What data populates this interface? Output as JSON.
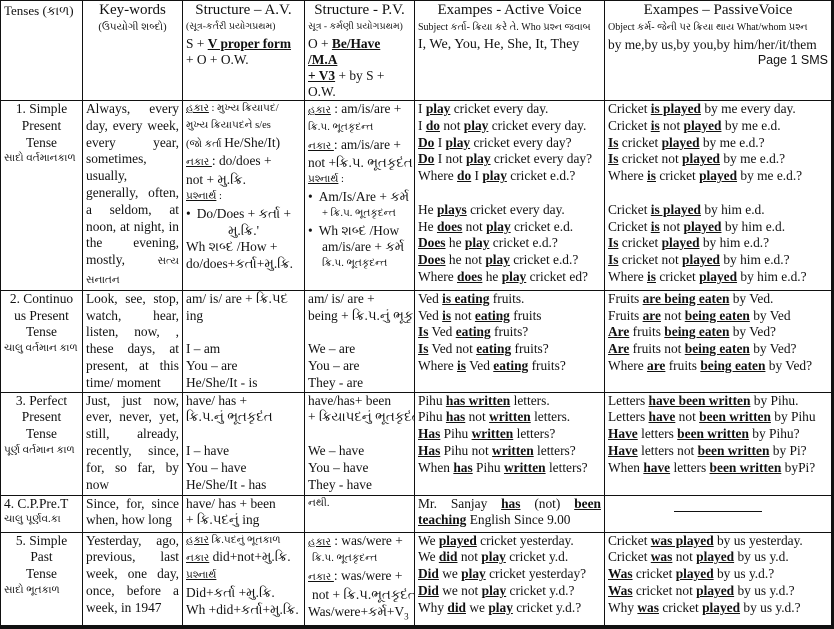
{
  "header": {
    "tenses": "Tenses (કાળ)",
    "keywords_title": "Key-words",
    "keywords_sub": "(ઉપયોગી શબ્દો)",
    "structure_av_title": "Structure – A.V.",
    "structure_av_sub": "(સૂત્ર-કર્તરી પ્રયોગપ્રથમ)",
    "structure_av_formula_s": "S + ",
    "structure_av_formula_v": "V proper form ",
    "structure_av_formula_end": "+ O + O.W.",
    "structure_pv_title": "Structure - P.V.",
    "structure_pv_sub": "સૂત્ર - કર્મણી પ્રયોગપ્રથમ)",
    "structure_pv_formula_o": "O + ",
    "structure_pv_formula_be": "Be/Have /M.A",
    "structure_pv_formula_v3": "+ V3",
    "structure_pv_formula_end": " + by S + O.W.",
    "active_title": "Exampes - Active Voice",
    "active_sub": "Subject કર્તા- ક્રિયા કરે તે. Who પ્રશ્ન જવાબ",
    "active_pronouns": "I,  We, You, He, She, It, They",
    "passive_title": "Exampes – PassiveVoice",
    "passive_sub": "Object કર્મ- જેની પર ક્રિયા થાય What/whom  પ્રશ્ન",
    "passive_pronouns": "by me,by us,by you,by him/her/it/them",
    "page_label": "Page 1 SMS"
  },
  "rows": [
    {
      "tense": [
        "1. Simple",
        "Present",
        "Tense"
      ],
      "tense_gu": "સાદો વર્તમાનકાળ",
      "keywords": "Always, every day, every week, every year, sometimes, usually, generally, often, a seldom, at noon, at night, in the evening, mostly,",
      "keywords_gu": "સત્ય સનાતન",
      "structure_av": {
        "l1_label": "હકાર",
        "l1": " : મુખ્ય ક્રિયાપદ/",
        "l2": "મુખ્ય ક્રિયાપદને s/es",
        "l3_gu": "(જો કર્તા ",
        "l3": "He/She/It)",
        "l4_label": "નકાર ",
        "l4": ": do/does +",
        "l5": "not + મુ.ક્રિ.",
        "l6_label": "પ્રશ્નાર્થ",
        "l6": " :",
        "l7": "Do/Does + કર્તા +",
        "l8": "મુ.ક્રિ.'",
        "l9": "Wh શબ્દ /How +",
        "l10": "do/does+કર્તા+મુ.ક્રિ."
      },
      "structure_pv": {
        "l1_label": "હકાર",
        "l1": " : am/is/are +",
        "l2": "ક્રિ.પ. ભૂતકૃદન્ત",
        "l3_label": "નકાર ",
        "l3": ": am/is/are +",
        "l4": "not +ક્રિ.પ. ભૂતકૃદંત",
        "l5_label": "પ્રશ્નાર્થ",
        "l5": " :",
        "l6": "Am/Is/Are + કર્મ",
        "l7": "+ ક્રિ.પ. ભૂતકૃદન્ત",
        "l8": "Wh શબ્દ /How",
        "l9": "am/is/are + કર્મ",
        "l10": "ક્રિ.પ. ભૂતકૃદન્ત"
      },
      "active": [
        [
          "I ",
          "play",
          " cricket every day."
        ],
        [
          "I ",
          "do",
          " not ",
          "play",
          " cricket every day."
        ],
        [
          "Do",
          " I ",
          "play",
          " cricket every day?"
        ],
        [
          "Do",
          " I not ",
          "play",
          " cricket every day?"
        ],
        [
          "Where ",
          "do",
          " I ",
          "play",
          " cricket e.d.?"
        ],
        [
          "He ",
          "plays",
          " cricket every day."
        ],
        [
          "He ",
          "does",
          " not ",
          "play",
          " cricket e.d."
        ],
        [
          "Does",
          " he ",
          "play",
          " cricket e.d.?"
        ],
        [
          "Does",
          " he not  ",
          "play",
          " cricket e.d.?"
        ],
        [
          "Where ",
          "does",
          " he ",
          "play",
          " cricket ed?"
        ]
      ],
      "passive": [
        [
          "Cricket ",
          "is played",
          " by me every day."
        ],
        [
          "Cricket ",
          "is",
          " not ",
          "played",
          " by me e.d."
        ],
        [
          "Is",
          " cricket ",
          "played",
          " by me e.d.?"
        ],
        [
          "Is",
          " cricket not ",
          "played",
          " by me e.d.?"
        ],
        [
          "Where ",
          "is",
          " cricket ",
          "played",
          " by me e.d.?"
        ],
        [
          "Cricket ",
          "is played",
          " by him e.d."
        ],
        [
          "Cricket ",
          "is",
          " not ",
          "played",
          " by him e.d."
        ],
        [
          "Is",
          " cricket ",
          "played",
          " by him e.d.?"
        ],
        [
          "Is",
          " cricket not  ",
          "played",
          " by him e.d.?"
        ],
        [
          "Where ",
          "is",
          " cricket ",
          "played",
          " by him e.d.?"
        ]
      ]
    },
    {
      "tense": [
        "2. Continuo",
        "us Present",
        "Tense"
      ],
      "tense_gu": "ચાલુ વર્તમાન કાળ",
      "keywords": "Look, see, stop, watch, hear, listen, now, , these days, at present, at this time/ moment",
      "structure_av": [
        "am/ is/ are + ક્રિ.પદ",
        "ing",
        "",
        "I – am",
        "You – are",
        "He/She/It - is"
      ],
      "structure_pv": [
        "am/ is/ are +",
        "being + ક્રિ.પ.નું ભૂકૃ",
        "",
        "We – are",
        "You – are",
        "They - are"
      ],
      "active": [
        [
          "Ved ",
          "is eating",
          " fruits."
        ],
        [
          "Ved ",
          "is",
          " not ",
          "eating",
          " fruits"
        ],
        [
          "Is",
          " Ved ",
          "eating",
          " fruits?"
        ],
        [
          "Is",
          " Ved not ",
          "eating",
          " fruits?"
        ],
        [
          "Where ",
          "is",
          " Ved ",
          "eating",
          " fruits?"
        ]
      ],
      "passive": [
        [
          "Fruits ",
          "are being eaten",
          " by Ved."
        ],
        [
          "Fruits ",
          "are",
          " not ",
          "being eaten",
          " by  Ved"
        ],
        [
          "Are",
          " fruits ",
          "being eaten",
          " by Ved?"
        ],
        [
          "Are",
          " fruits not ",
          "being eaten",
          " by Ved?"
        ],
        [
          "Where ",
          "are",
          "  fruits ",
          "being eaten",
          " by Ved?"
        ]
      ]
    },
    {
      "tense": [
        "3. Perfect",
        "Present",
        "Tense"
      ],
      "tense_gu": "પૂર્ણ વર્તમાન કાળ",
      "keywords": "Just, just now, ever, never, yet, still, already, recently, since, for, so far, by now",
      "structure_av": [
        "have/ has +",
        "ક્રિ.પ.નું ભૂતકૃદંત",
        "",
        "I – have",
        "You – have",
        "He/She/It - has"
      ],
      "structure_pv": [
        "have/has+ been",
        "+ ક્રિયાપદનું ભૂતકૃદંત",
        "",
        "We – have",
        "You – have",
        "They -  have"
      ],
      "active": [
        [
          "Pihu ",
          "has written",
          " letters."
        ],
        [
          "Pihu ",
          "has",
          " not ",
          "written",
          " letters."
        ],
        [
          "Has",
          " Pihu ",
          "written",
          " letters?"
        ],
        [
          "Has",
          " Pihu not ",
          "written",
          " letters?"
        ],
        [
          "When ",
          "has",
          " Pihu ",
          "written",
          " letters?"
        ]
      ],
      "passive": [
        [
          "Letters ",
          "have been written",
          " by Pihu."
        ],
        [
          "Letters ",
          "have",
          " not ",
          "been written",
          " by Pihu"
        ],
        [
          "Have",
          " letters ",
          "been written",
          " by Pihu?"
        ],
        [
          "Have",
          " letters not ",
          "been written",
          " by Pi?"
        ],
        [
          "When ",
          "have",
          " letters  ",
          "been written",
          " byPi?"
        ]
      ]
    },
    {
      "tense": [
        "4. C.P.Pre.T"
      ],
      "tense_gu": "ચાલુ પૂર્ણવ.કા",
      "keywords": "Since, for, since when, how long",
      "structure_av": [
        "have/ has + been",
        "+ ક્રિ.પદનું ing"
      ],
      "structure_pv": [
        "નથી."
      ],
      "active_parts": [
        "Mr.  Sanjay  ",
        "has",
        "  (not)  ",
        "been",
        "teaching",
        " English Since 9.00"
      ],
      "passive_blank": "blank-line"
    },
    {
      "tense": [
        "5. Simple",
        "Past",
        "Tense"
      ],
      "tense_gu": "સાદો ભૂતકાળ",
      "keywords": "Yesterday, ago, previous, last week, one day, once, before a week, in 1947",
      "structure_av": {
        "l1_label": "હકાર",
        "l1": "  ક્રિ.પદનું ભૂતકાળ",
        "l2_label": "નકાર",
        "l2": " did+not+મુ.ક્રિ.",
        "l3_label": "પ્રશ્નાર્થ",
        "l4": "Did+કર્તા +મુ.ક્રિ.",
        "l5": "Wh +did+કર્તા+મુ.ક્રિ."
      },
      "structure_pv": {
        "l1_label": "હકાર",
        "l1": " : was/were +",
        "l2": "ક્રિ.પ. ભૂતકૃદન્ત",
        "l3_label": "નકાર ",
        "l3": ": was/were +",
        "l4": "not + ક્રિ.પ.ભૂતકૃદંત",
        "l5": "Was/were+કર્મ+V",
        "l5_sub": "3"
      },
      "active": [
        [
          "We ",
          "played",
          " cricket yesterday."
        ],
        [
          "We ",
          "did",
          " not ",
          "play",
          " cricket y.d."
        ],
        [
          "Did",
          " we ",
          "play",
          " cricket yesterday?"
        ],
        [
          "Did",
          " we not ",
          "play",
          " cricket y.d.?"
        ],
        [
          "Why ",
          "did",
          " we ",
          "play",
          " cricket y.d.?"
        ]
      ],
      "passive": [
        [
          "Cricket ",
          "was played",
          " by us yesterday."
        ],
        [
          "Cricket ",
          "was",
          " not ",
          "played",
          " by us y.d."
        ],
        [
          "Was",
          " cricket ",
          "played",
          " by us y.d.?"
        ],
        [
          "Was",
          " cricket not ",
          "played",
          " by us y.d.?"
        ],
        [
          "Why ",
          "was",
          " cricket ",
          "played",
          " by us y.d.?"
        ]
      ]
    }
  ]
}
